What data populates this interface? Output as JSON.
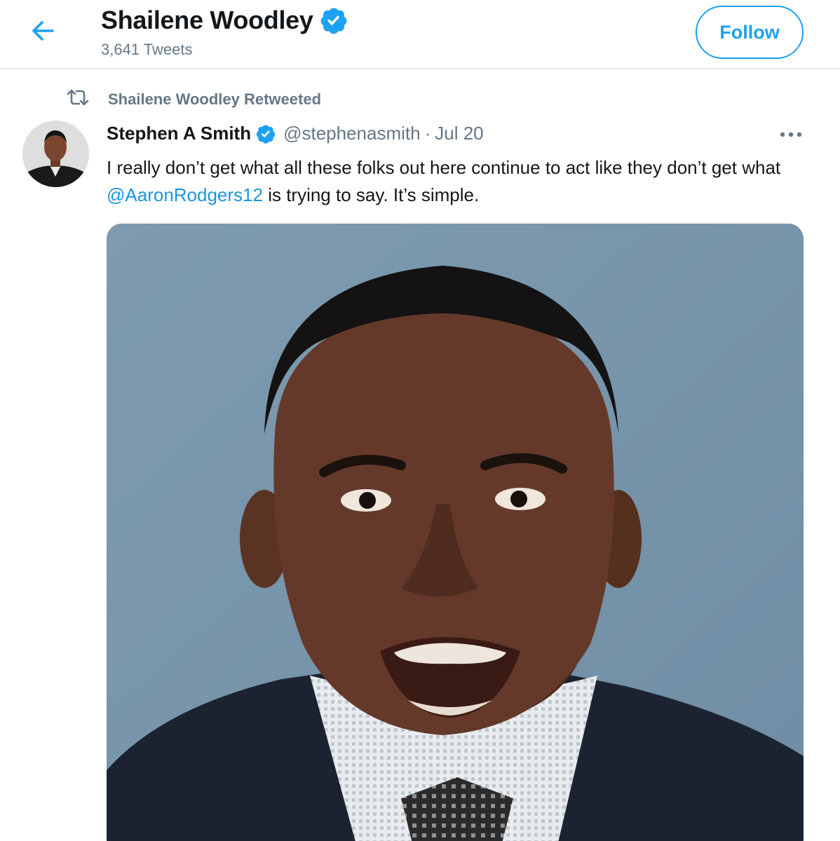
{
  "header": {
    "back_icon": "arrow-left-icon",
    "profile_name": "Shailene Woodley",
    "verified_icon": "verified-badge-icon",
    "tweet_count": "3,641 Tweets",
    "follow_label": "Follow"
  },
  "retweet_context": {
    "icon": "retweet-icon",
    "label": "Shailene Woodley Retweeted"
  },
  "tweet": {
    "author_name": "Stephen A Smith",
    "author_handle": "@stephenasmith",
    "separator": "·",
    "date": "Jul 20",
    "text_before": "I really don’t get what all these folks out here continue to act like they don’t get what ",
    "mention": "@AaronRodgers12",
    "text_after": " is trying to say. It’s simple.",
    "more_icon": "more-options-icon"
  },
  "colors": {
    "accent": "#1da1f2",
    "link": "#1b95e0",
    "secondary_text": "#657786",
    "primary_text": "#14171a",
    "divider": "#e6ecf0"
  }
}
